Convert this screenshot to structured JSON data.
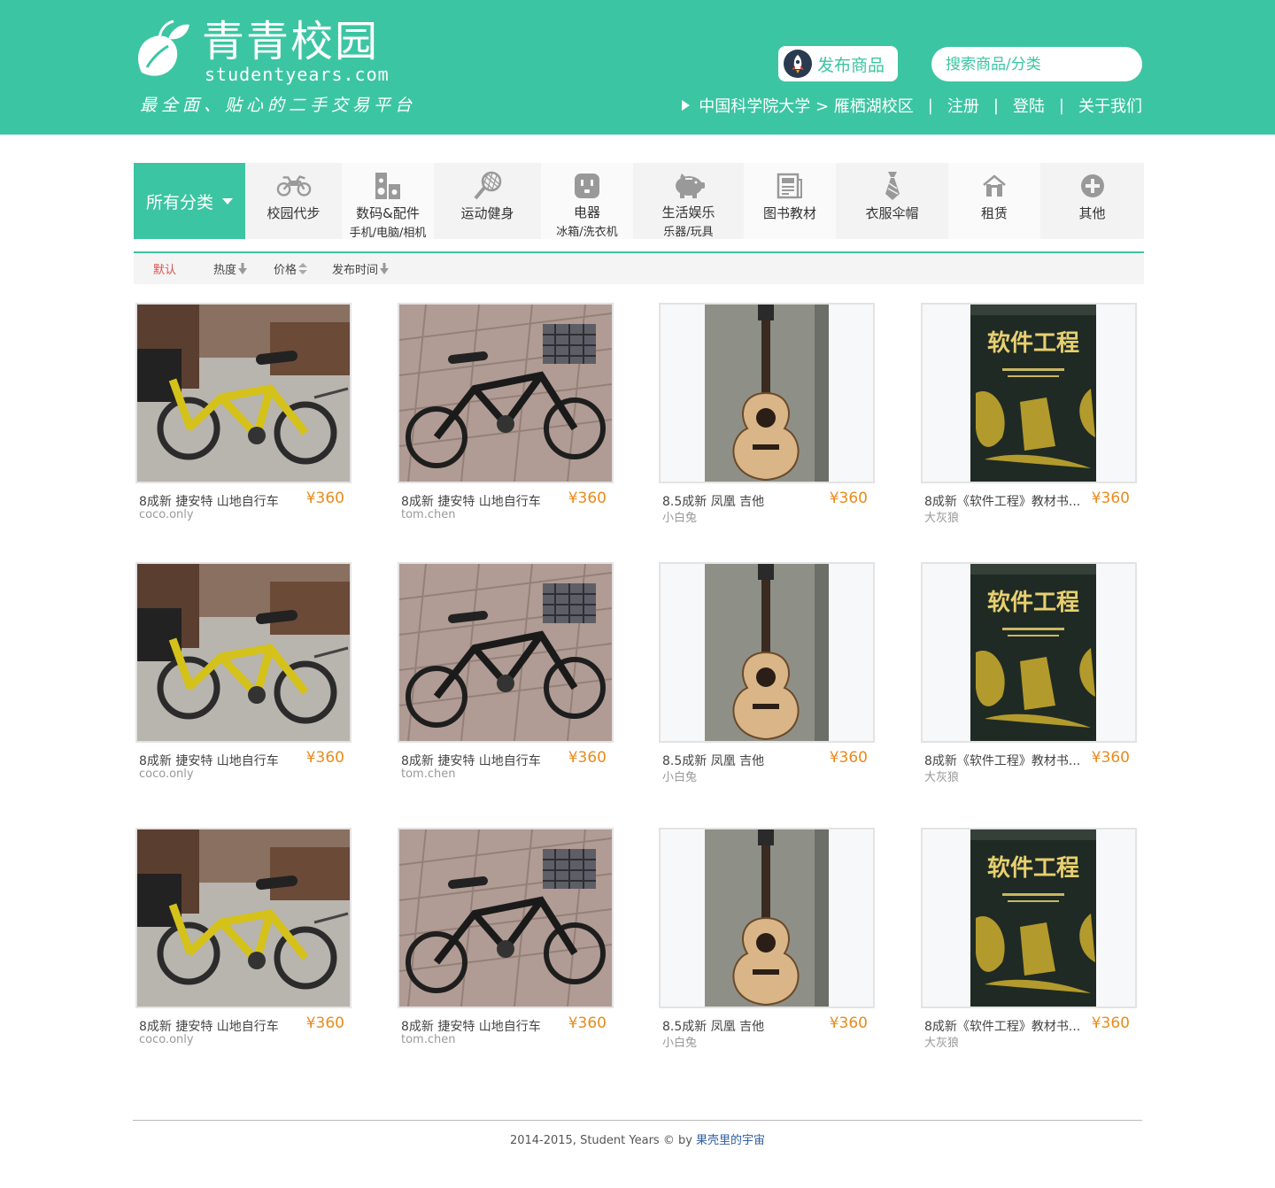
{
  "brand": {
    "title": "青青校园",
    "domain": "studentyears.com",
    "slogan": "最全面、贴心的二手交易平台"
  },
  "header": {
    "publish_label": "发布商品",
    "search_placeholder": "搜索商品/分类",
    "school": "中国科学院大学 > 雁栖湖校区",
    "register": "注册",
    "login": "登陆",
    "about": "关于我们",
    "separator": "|"
  },
  "colors": {
    "brand_green": "#3cc5a2",
    "price_orange": "#e98b1c",
    "active_red": "#d9534f"
  },
  "categories": {
    "all_label": "所有分类",
    "items": [
      {
        "label": "校园代步",
        "sub": "",
        "icon": "motorcycle-icon"
      },
      {
        "label": "数码&配件",
        "sub": "手机/电脑/相机",
        "icon": "speaker-icon"
      },
      {
        "label": "运动健身",
        "sub": "",
        "icon": "tennis-racket-icon"
      },
      {
        "label": "电器",
        "sub": "冰箱/洗衣机",
        "icon": "power-socket-icon"
      },
      {
        "label": "生活娱乐",
        "sub": "乐器/玩具",
        "icon": "piggy-bank-icon"
      },
      {
        "label": "图书教材",
        "sub": "",
        "icon": "newspaper-icon"
      },
      {
        "label": "衣服伞帽",
        "sub": "",
        "icon": "tie-icon"
      },
      {
        "label": "租赁",
        "sub": "",
        "icon": "house-icon"
      },
      {
        "label": "其他",
        "sub": "",
        "icon": "plus-circle-icon"
      }
    ]
  },
  "sort": {
    "default": "默认",
    "heat": "热度",
    "price": "价格",
    "time": "发布时间"
  },
  "products": [
    {
      "title": "8成新 捷安特  山地自行车",
      "price": "¥360",
      "seller": "coco.only",
      "image": "yellow-bike"
    },
    {
      "title": "8成新 捷安特  山地自行车",
      "price": "¥360",
      "seller": "tom.chen",
      "image": "black-bike"
    },
    {
      "title": "8.5成新 凤凰  吉他",
      "price": "¥360",
      "seller": "小白兔",
      "image": "guitar"
    },
    {
      "title": "8成新《软件工程》教材书...",
      "price": "¥360",
      "seller": "大灰狼",
      "image": "book",
      "book_title": "软件工程"
    },
    {
      "title": "8成新 捷安特  山地自行车",
      "price": "¥360",
      "seller": "coco.only",
      "image": "yellow-bike"
    },
    {
      "title": "8成新 捷安特  山地自行车",
      "price": "¥360",
      "seller": "tom.chen",
      "image": "black-bike"
    },
    {
      "title": "8.5成新 凤凰  吉他",
      "price": "¥360",
      "seller": "小白兔",
      "image": "guitar"
    },
    {
      "title": "8成新《软件工程》教材书...",
      "price": "¥360",
      "seller": "大灰狼",
      "image": "book",
      "book_title": "软件工程"
    },
    {
      "title": "8成新 捷安特  山地自行车",
      "price": "¥360",
      "seller": "coco.only",
      "image": "yellow-bike"
    },
    {
      "title": "8成新 捷安特  山地自行车",
      "price": "¥360",
      "seller": "tom.chen",
      "image": "black-bike"
    },
    {
      "title": "8.5成新 凤凰  吉他",
      "price": "¥360",
      "seller": "小白兔",
      "image": "guitar"
    },
    {
      "title": "8成新《软件工程》教材书...",
      "price": "¥360",
      "seller": "大灰狼",
      "image": "book",
      "book_title": "软件工程"
    }
  ],
  "footer": {
    "copyright": "2014-2015, Student Years © by ",
    "author": "果壳里的宇宙"
  }
}
